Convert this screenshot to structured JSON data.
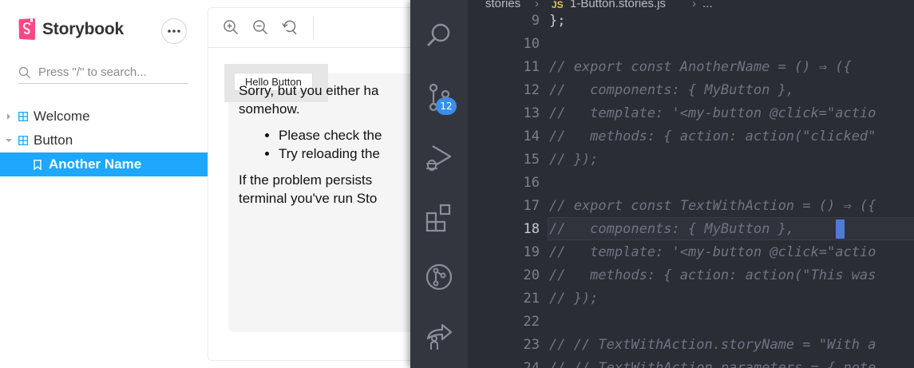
{
  "storybook": {
    "brand": "Storybook",
    "search": {
      "placeholder": "Press \"/\" to search..."
    },
    "tree": [
      {
        "label": "Welcome",
        "kind": "component",
        "expanded": false
      },
      {
        "label": "Button",
        "kind": "component",
        "expanded": true
      },
      {
        "label": "Another Name",
        "kind": "story",
        "selected": true
      }
    ],
    "accent_color": "#1ea7fd"
  },
  "preview": {
    "toolbar": [
      "zoom-in-icon",
      "zoom-out-icon",
      "reset-zoom-icon"
    ],
    "hello_button_label": "Hello Button",
    "error": {
      "line1": "Sorry, but you either ha",
      "line2": "somehow.",
      "bullets": [
        "Please check the",
        "Try reloading the"
      ],
      "line3": "If the problem persists",
      "line4": "terminal you've run Sto"
    }
  },
  "vscode": {
    "breadcrumb": {
      "folder": "stories",
      "file_badge": "JS",
      "file": "1-Button.stories.js",
      "more": "..."
    },
    "scm_badge": "12",
    "activity_icons": [
      "search-icon",
      "source-control-icon",
      "run-debug-icon",
      "extensions-icon",
      "git-graph-icon",
      "live-share-icon"
    ],
    "current_line": 18,
    "lines": [
      {
        "no": "9",
        "text": "};"
      },
      {
        "no": "10",
        "text": ""
      },
      {
        "no": "11",
        "text": "// export const AnotherName = () ⇒ ({"
      },
      {
        "no": "12",
        "text": "//   components: { MyButton },"
      },
      {
        "no": "13",
        "text": "//   template: '<my-button @click=\"actio"
      },
      {
        "no": "14",
        "text": "//   methods: { action: action(\"clicked\""
      },
      {
        "no": "15",
        "text": "// });"
      },
      {
        "no": "16",
        "text": ""
      },
      {
        "no": "17",
        "text": "// export const TextWithAction = () ⇒ ({"
      },
      {
        "no": "18",
        "text": "//   components: { MyButton },"
      },
      {
        "no": "19",
        "text": "//   template: '<my-button @click=\"actio"
      },
      {
        "no": "20",
        "text": "//   methods: { action: action(\"This was"
      },
      {
        "no": "21",
        "text": "// });"
      },
      {
        "no": "22",
        "text": ""
      },
      {
        "no": "23",
        "text": "// // TextWithAction.storyName = \"With a"
      },
      {
        "no": "24",
        "text": "// // TextWithAction.parameters = { note"
      }
    ]
  }
}
